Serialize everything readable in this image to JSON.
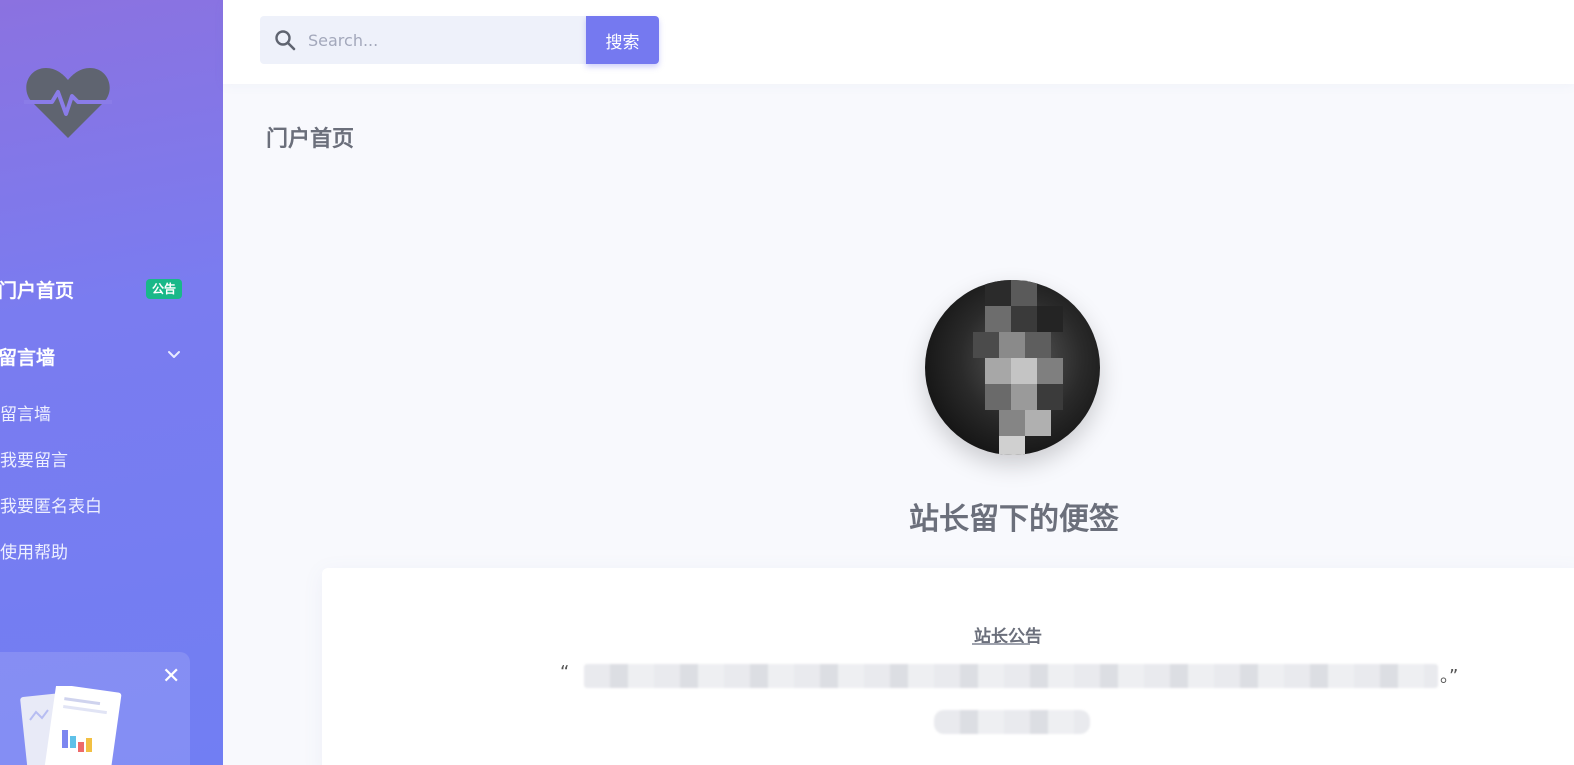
{
  "sidebar": {
    "logo_icon": "heart-pulse-icon",
    "nav": [
      {
        "label": "门户首页",
        "badge": "公告"
      },
      {
        "label": "留言墙",
        "icon": "chevron-down-icon"
      }
    ],
    "sub_items": [
      {
        "label": "留言墙"
      },
      {
        "label": "我要留言"
      },
      {
        "label": "我要匿名表白"
      },
      {
        "label": "使用帮助"
      }
    ],
    "promo": {
      "close_icon": "close-icon",
      "close_glyph": "✕"
    }
  },
  "topbar": {
    "search": {
      "placeholder": "Search...",
      "value": "",
      "icon": "search-icon"
    },
    "search_button": "搜索"
  },
  "main": {
    "page_title": "门户首页",
    "note_title": "站长留下的便签",
    "card": {
      "title": "站长公告",
      "quote_open": "“",
      "quote_close": "。”"
    }
  },
  "colors": {
    "sidebar_start": "#8b72e0",
    "sidebar_end": "#717ef3",
    "accent": "#7579f0",
    "badge": "#19b889",
    "text_muted": "#6b6f7b"
  }
}
